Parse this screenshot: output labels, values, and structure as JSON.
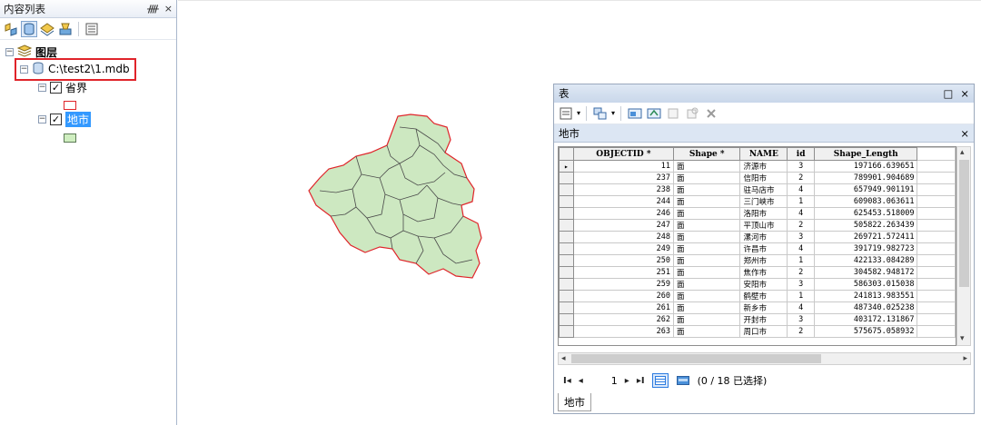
{
  "toc": {
    "title": "内容列表",
    "controls": {
      "pin": "ᚎ",
      "close": "×"
    },
    "toolbar_icons": [
      "list-by-drawing-order-icon",
      "list-by-source-icon",
      "list-by-visibility-icon",
      "list-by-selection-icon",
      "options-icon"
    ],
    "layers_label": "图层",
    "source_path": "C:\\test2\\1.mdb",
    "layer1_label": "省界",
    "layer1_color": "#e0242a",
    "layer2_label": "地市",
    "layer2_color": "#cfeec0",
    "layer2_outline": "#5c7a55",
    "highlight_color": "#e0242a"
  },
  "map": {
    "fill": "#cde8c1",
    "internal_border": "#4a4a4a",
    "outer_border": "#e0242a"
  },
  "table": {
    "window_title": "表",
    "window_controls": {
      "restore": "□",
      "close": "×"
    },
    "subtitle": "地市",
    "subtitle_close": "×",
    "columns": [
      "OBJECTID *",
      "Shape *",
      "NAME",
      "id",
      "Shape_Length"
    ],
    "rows": [
      {
        "oid": "11",
        "shape": "面",
        "name": "济源市",
        "id": "3",
        "len": "197166.639651"
      },
      {
        "oid": "237",
        "shape": "面",
        "name": "信阳市",
        "id": "2",
        "len": "789901.904689"
      },
      {
        "oid": "238",
        "shape": "面",
        "name": "驻马店市",
        "id": "4",
        "len": "657949.901191"
      },
      {
        "oid": "244",
        "shape": "面",
        "name": "三门峡市",
        "id": "1",
        "len": "609083.063611"
      },
      {
        "oid": "246",
        "shape": "面",
        "name": "洛阳市",
        "id": "4",
        "len": "625453.518009"
      },
      {
        "oid": "247",
        "shape": "面",
        "name": "平顶山市",
        "id": "2",
        "len": "505822.263439"
      },
      {
        "oid": "248",
        "shape": "面",
        "name": "漯河市",
        "id": "3",
        "len": "269721.572411"
      },
      {
        "oid": "249",
        "shape": "面",
        "name": "许昌市",
        "id": "4",
        "len": "391719.982723"
      },
      {
        "oid": "250",
        "shape": "面",
        "name": "郑州市",
        "id": "1",
        "len": "422133.084289"
      },
      {
        "oid": "251",
        "shape": "面",
        "name": "焦作市",
        "id": "2",
        "len": "304582.948172"
      },
      {
        "oid": "259",
        "shape": "面",
        "name": "安阳市",
        "id": "3",
        "len": "586303.015038"
      },
      {
        "oid": "260",
        "shape": "面",
        "name": "鹤壁市",
        "id": "1",
        "len": "241813.983551"
      },
      {
        "oid": "261",
        "shape": "面",
        "name": "新乡市",
        "id": "4",
        "len": "487340.025238"
      },
      {
        "oid": "262",
        "shape": "面",
        "name": "开封市",
        "id": "3",
        "len": "403172.131867"
      },
      {
        "oid": "263",
        "shape": "面",
        "name": "周口市",
        "id": "2",
        "len": "575675.058932"
      }
    ],
    "current_record": "1",
    "selection_text": "(0 / 18 已选择)",
    "tab_label": "地市",
    "nav": {
      "first": "I◂",
      "prev": "◂",
      "next": "▸",
      "last": "▸I"
    }
  }
}
